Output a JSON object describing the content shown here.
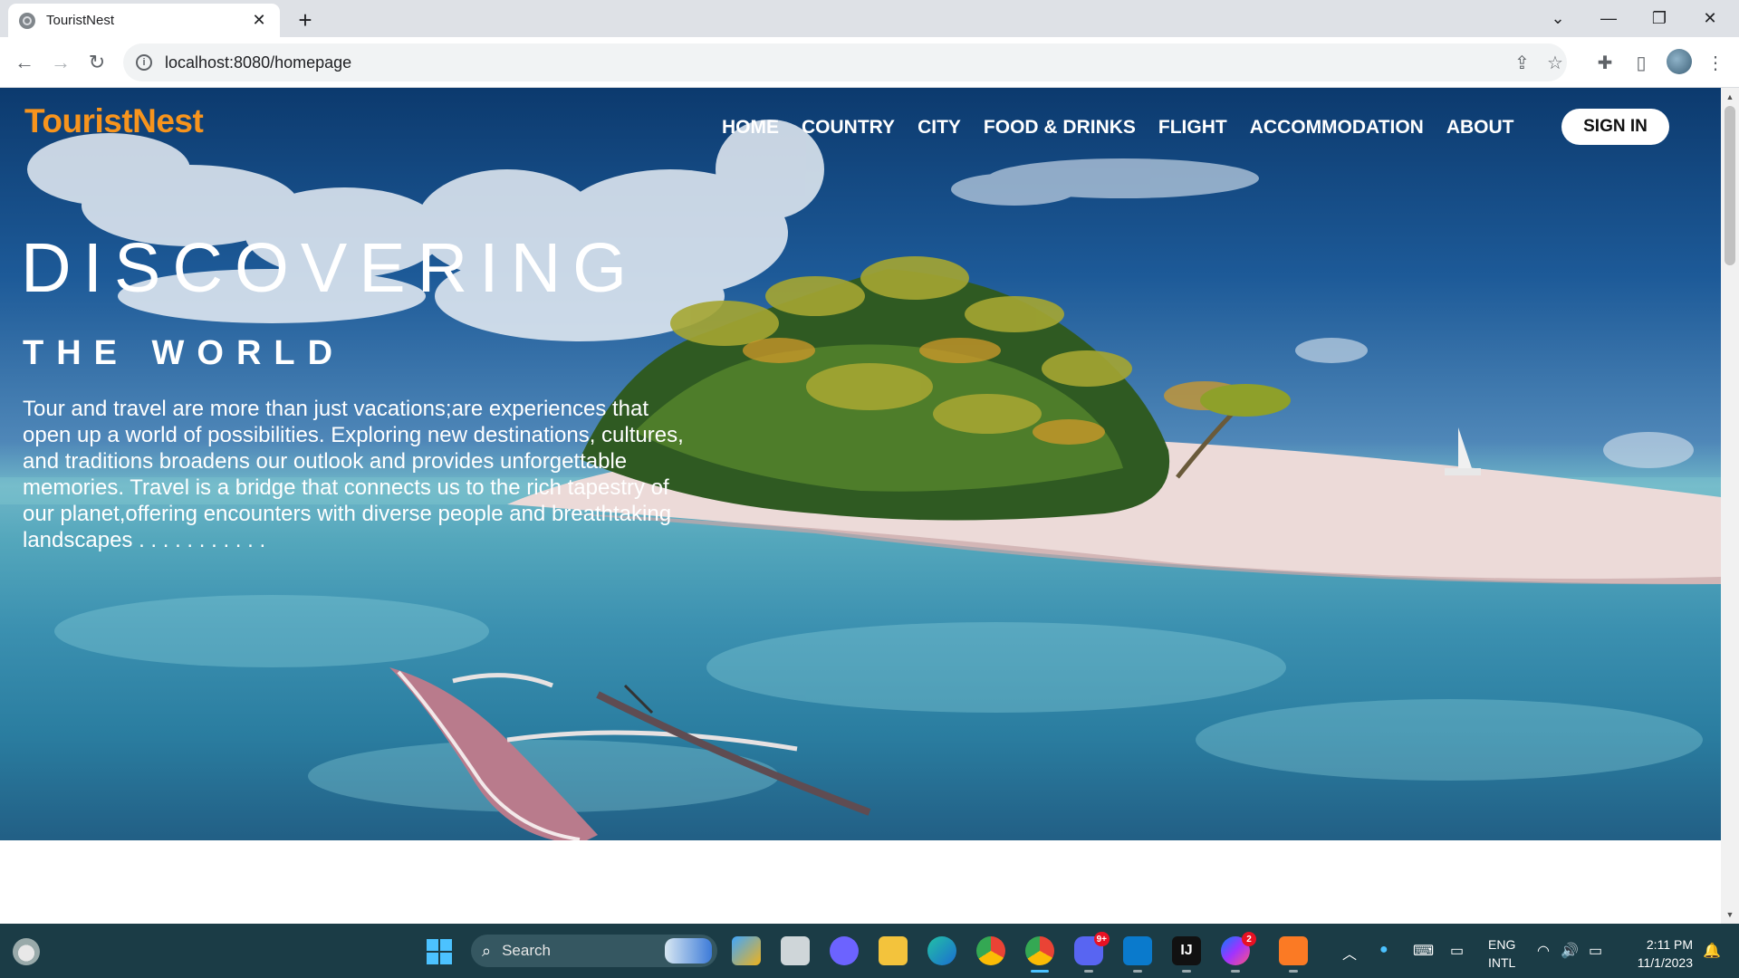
{
  "browser": {
    "tab_title": "TouristNest",
    "tab_close": "✕",
    "new_tab": "+",
    "url": "localhost:8080/homepage",
    "window_controls": {
      "minimize": "—",
      "maximize": "❐",
      "close": "✕",
      "tab_search": "⌄"
    }
  },
  "site": {
    "logo": "TouristNest",
    "nav": [
      "HOME",
      "COUNTRY",
      "CITY",
      "FOOD & DRINKS",
      "FLIGHT",
      "ACCOMMODATION",
      "ABOUT"
    ],
    "signin": "SIGN IN",
    "headline": "DISCOVERING",
    "subheadline": "THE WORLD",
    "intro": "Tour and travel are more than just vacations;are experiences that open up a world of possibilities. Exploring new destinations, cultures, and traditions broadens our outlook and provides unforgettable memories. Travel is a bridge that connects us to the rich tapestry of our planet,offering encounters with diverse people and breathtaking landscapes . . . . . . . . . . .",
    "colors": {
      "logo": "#f7941d",
      "nav_text": "#ffffff",
      "signin_bg": "#ffffff"
    }
  },
  "taskbar": {
    "search_placeholder": "Search",
    "apps": [
      {
        "name": "Copilot",
        "label": ""
      },
      {
        "name": "Task View",
        "label": ""
      },
      {
        "name": "Zoom",
        "label": ""
      },
      {
        "name": "File Explorer",
        "label": ""
      },
      {
        "name": "Edge Dev",
        "label": ""
      },
      {
        "name": "Chrome",
        "label": ""
      },
      {
        "name": "Chrome (active)",
        "label": ""
      },
      {
        "name": "Discord",
        "label": "",
        "badge": "9+"
      },
      {
        "name": "VS Code",
        "label": ""
      },
      {
        "name": "IntelliJ IDEA",
        "label": "IJ"
      },
      {
        "name": "Messenger",
        "label": "",
        "badge": "2"
      },
      {
        "name": "XAMPP",
        "label": ""
      }
    ],
    "tray": {
      "lang_line1": "ENG",
      "lang_line2": "INTL",
      "time": "2:11 PM",
      "date": "11/1/2023"
    }
  }
}
